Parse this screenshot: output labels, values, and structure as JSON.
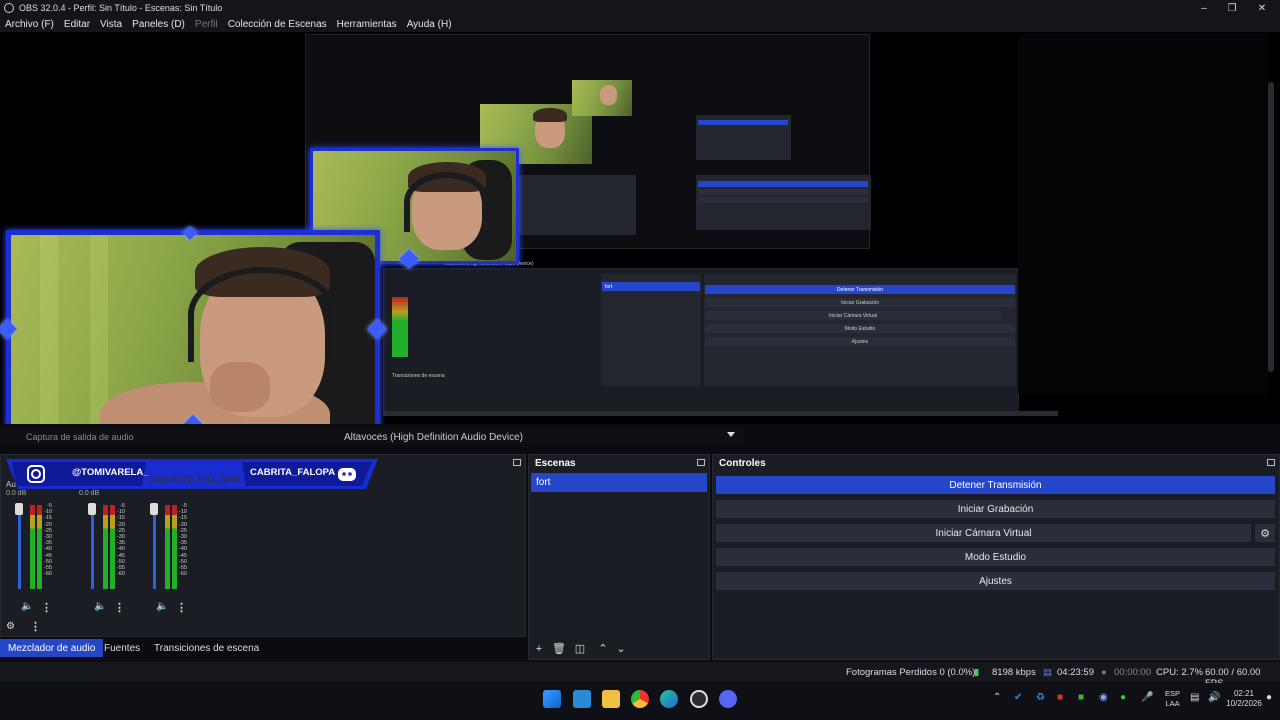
{
  "window": {
    "title": "OBS 32.0.4 - Perfil: Sin Título - Escenas: Sin Título"
  },
  "menu": [
    "Archivo (F)",
    "Editar",
    "Vista",
    "Paneles (D)",
    "Perfil",
    "Colección de Escenas",
    "Herramientas",
    "Ayuda (H)"
  ],
  "source_bar": {
    "left_text": "Captura de salida de audio",
    "device_text": "Altavoces (High Definition Audio Device)"
  },
  "overlay": {
    "instagram_handle": "@TOMIVARELA_",
    "mid_text": "CABRITA FALOPA",
    "discord_handle": "CABRITA_FALOPA"
  },
  "audio_mixer": {
    "label": "Au",
    "db_values": [
      "0.0 dB",
      "0.0 dB"
    ],
    "scale": [
      "-5",
      "-10",
      "-15",
      "-20",
      "-25",
      "-30",
      "-35",
      "-40",
      "-45",
      "-50",
      "-55",
      "-60"
    ]
  },
  "dock_tabs": [
    "Mezclador de audio",
    "Fuentes",
    "Transiciones de escena"
  ],
  "scenes": {
    "title": "Escenas",
    "items": [
      "fort"
    ]
  },
  "controls": {
    "title": "Controles",
    "buttons": [
      "Detener Transmisión",
      "Iniciar Grabación",
      "Iniciar Cámara Virtual",
      "Modo Estudio",
      "Ajustes"
    ]
  },
  "status": {
    "dropped_frames": "Fotogramas Perdidos 0 (0.0%)",
    "bitrate": "8198 kbps",
    "stream_time": "04:23:59",
    "rec_time": "00:00:00",
    "cpu": "CPU: 2.7%",
    "fps": "60.00 / 60.00 FPS"
  },
  "nested_preview": {
    "controls_buttons": [
      "Detener Transmisión",
      "Iniciar Grabación",
      "Iniciar Cámara Virtual",
      "Modo Estudio",
      "Ajustes"
    ],
    "scene_item": "fort",
    "transitions_label": "Transiciones de escena",
    "device_label": "Altavoces (High Definition Audio Device)"
  },
  "taskbar": {
    "language": "ESP",
    "layout": "LAA",
    "time": "02:21",
    "date": "10/2/2026"
  },
  "colors": {
    "accent": "#2546c9",
    "panel": "#1b1d24",
    "frame_blue": "#1f2fd6"
  }
}
